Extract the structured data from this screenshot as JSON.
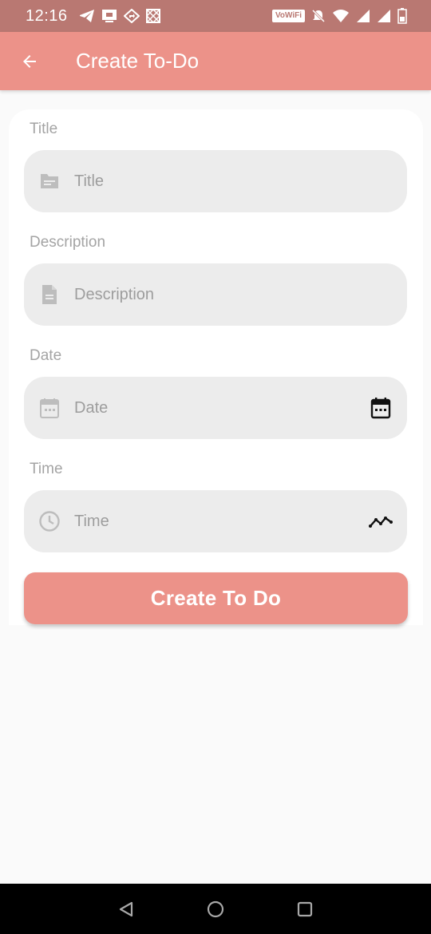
{
  "status_bar": {
    "time": "12:16",
    "vowifi": "VoWiFi"
  },
  "app_bar": {
    "title": "Create To-Do"
  },
  "form": {
    "title": {
      "label": "Title",
      "placeholder": "Title"
    },
    "description": {
      "label": "Description",
      "placeholder": "Description"
    },
    "date": {
      "label": "Date",
      "placeholder": "Date"
    },
    "time": {
      "label": "Time",
      "placeholder": "Time"
    },
    "submit_label": "Create To Do"
  },
  "colors": {
    "accent": "#ec9289",
    "status_bar": "#b97872",
    "field_bg": "#ececec",
    "label": "#a4a4a4"
  },
  "icons": {
    "back": "arrow-left-icon",
    "title_field": "folder-icon",
    "description_field": "document-icon",
    "date_field": "calendar-icon",
    "date_picker": "calendar-icon",
    "time_field": "clock-icon",
    "time_picker": "trend-line-icon"
  }
}
